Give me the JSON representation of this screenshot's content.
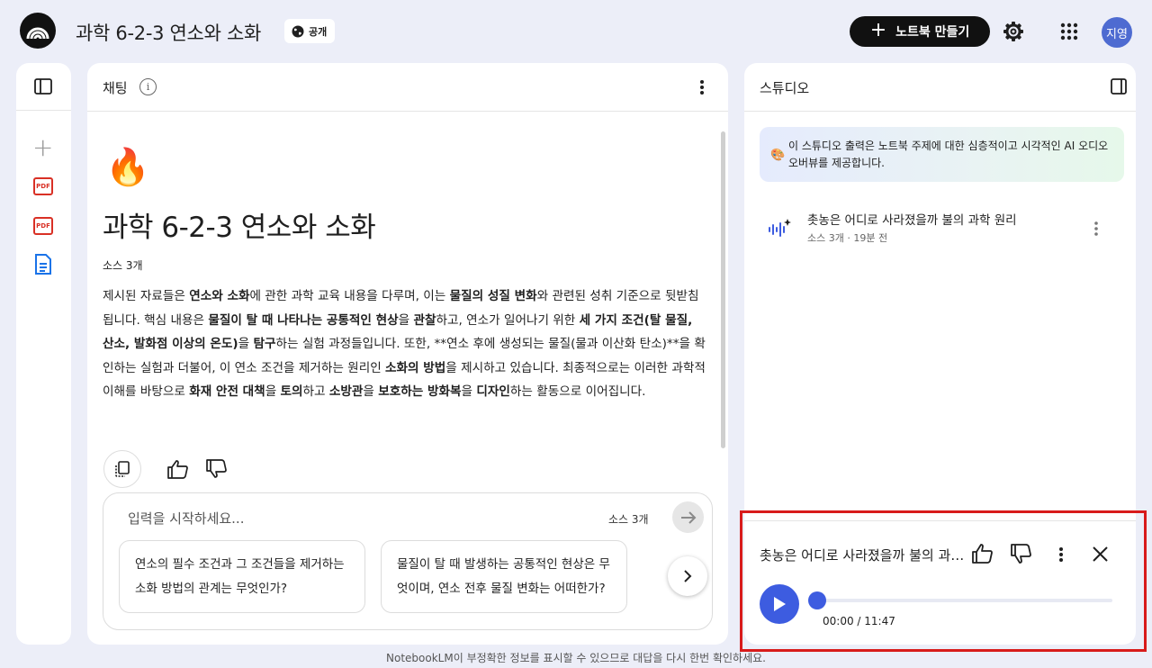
{
  "header": {
    "notebook_title": "과학 6-2-3 연소와 소화",
    "visibility_label": "공개",
    "create_button_label": "노트북 만들기",
    "create_button_icon": "plus-icon",
    "avatar_text": "지영"
  },
  "sources_panel": {
    "items": [
      {
        "type": "pdf",
        "label": "PDF"
      },
      {
        "type": "pdf",
        "label": "PDF"
      },
      {
        "type": "doc",
        "label": ""
      }
    ]
  },
  "chat": {
    "panel_title": "채팅",
    "emoji": "🔥",
    "title": "과학 6-2-3 연소와 소화",
    "source_count": "소스 3개",
    "summary": [
      {
        "text": "제시된 자료들은 ",
        "bold": false
      },
      {
        "text": "연소와 소화",
        "bold": true
      },
      {
        "text": "에 관한 과학 교육 내용을 다루며, 이는 ",
        "bold": false
      },
      {
        "text": "물질의 성질 변화",
        "bold": true
      },
      {
        "text": "와 관련된 성취 기준으로 뒷받침됩니다. 핵심 내용은 ",
        "bold": false
      },
      {
        "text": "물질이 탈 때 나타나는 공통적인 현상",
        "bold": true
      },
      {
        "text": "을 ",
        "bold": false
      },
      {
        "text": "관찰",
        "bold": true
      },
      {
        "text": "하고, 연소가 일어나기 위한 ",
        "bold": false
      },
      {
        "text": "세 가지 조건(탈 물질, 산소, 발화점 이상의 온도)",
        "bold": true
      },
      {
        "text": "을 ",
        "bold": false
      },
      {
        "text": "탐구",
        "bold": true
      },
      {
        "text": "하는 실험 과정들입니다. 또한, **연소 후에 생성되는 물질(물과 이산화 탄소)**을 확인하는 실험과 더불어, 이 연소 조건을 제거하는 원리인 ",
        "bold": false
      },
      {
        "text": "소화의 방법",
        "bold": true
      },
      {
        "text": "을 제시하고 있습니다. 최종적으로는 이러한 과학적 이해를 바탕으로 ",
        "bold": false
      },
      {
        "text": "화재 안전 대책",
        "bold": true
      },
      {
        "text": "을 ",
        "bold": false
      },
      {
        "text": "토의",
        "bold": true
      },
      {
        "text": "하고 ",
        "bold": false
      },
      {
        "text": "소방관",
        "bold": true
      },
      {
        "text": "을 ",
        "bold": false
      },
      {
        "text": "보호하는 방화복",
        "bold": true
      },
      {
        "text": "을 ",
        "bold": false
      },
      {
        "text": "디자인",
        "bold": true
      },
      {
        "text": "하는 활동으로 이어집니다.",
        "bold": false
      }
    ],
    "input_placeholder": "입력을 시작하세요...",
    "input_source_count": "소스 3개",
    "suggestions": [
      "연소의 필수 조건과 그 조건들을 제거하는 소화 방법의 관계는 무엇인가?",
      "물질이 탈 때 발생하는 공통적인 현상은 무엇이며, 연소 전후 물질 변화는 어떠한가?"
    ]
  },
  "studio": {
    "panel_title": "스튜디오",
    "banner_icon": "palette-icon",
    "banner_text": "이 스튜디오 출력은 노트북 주제에 대한 심층적이고 시각적인 AI 오디오 오버뷰를 제공합니다.",
    "audio_item": {
      "title": "촛농은 어디로 사라졌을까 불의 과학 원리",
      "meta": "소스 3개 · 19분 전"
    },
    "player": {
      "title": "촛농은 어디로 사라졌을까 불의 과학 원리",
      "time": "00:00 / 11:47",
      "progress": 0
    }
  },
  "footer": {
    "disclaimer": "NotebookLM이 부정확한 정보를 표시할 수 있으므로 대답을 다시 한번 확인하세요."
  },
  "colors": {
    "accent": "#3d5ce0",
    "highlight": "#d81b1b",
    "pdf": "#d93025",
    "doc": "#1a73e8"
  }
}
